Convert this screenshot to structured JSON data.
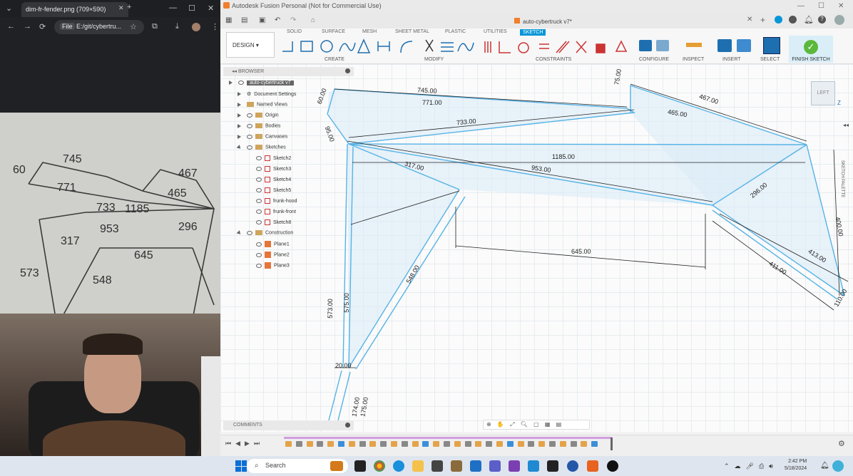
{
  "chrome": {
    "tab_title": "dim-fr-fender.png (709×590)",
    "address_prefix": "File",
    "address": "E:/git/cybertru..."
  },
  "fusion": {
    "window_title": "Autodesk Fusion Personal (Not for Commercial Use)",
    "doc_tab": "auto-cybertruck v7*",
    "tabs": [
      "SOLID",
      "SURFACE",
      "MESH",
      "SHEET METAL",
      "PLASTIC",
      "UTILITIES",
      "SKETCH"
    ],
    "active_tab": "SKETCH",
    "workspace": "DESIGN",
    "groups": [
      "CREATE",
      "MODIFY",
      "CONSTRAINTS",
      "CONFIGURE",
      "INSPECT",
      "INSERT",
      "SELECT"
    ],
    "finish_sketch": "FINISH SKETCH",
    "browser_title": "BROWSER",
    "comments_title": "COMMENTS",
    "viewcube_label": "LEFT",
    "side_palette": "SKETCH PALETTE",
    "browser_items": [
      {
        "label": "auto-cybertruck v7",
        "level": 0
      },
      {
        "label": "Document Settings",
        "level": 1
      },
      {
        "label": "Named Views",
        "level": 1
      },
      {
        "label": "Origin",
        "level": 1
      },
      {
        "label": "Bodies",
        "level": 1
      },
      {
        "label": "Canvases",
        "level": 1
      },
      {
        "label": "Sketches",
        "level": 1
      },
      {
        "label": "Sketch2",
        "level": 2
      },
      {
        "label": "Sketch3",
        "level": 2
      },
      {
        "label": "Sketch4",
        "level": 2
      },
      {
        "label": "Sketch5",
        "level": 2
      },
      {
        "label": "frunk-hood",
        "level": 2
      },
      {
        "label": "frunk-front",
        "level": 2
      },
      {
        "label": "Sketch8",
        "level": 2
      },
      {
        "label": "Construction",
        "level": 1
      },
      {
        "label": "Plane1",
        "level": 2
      },
      {
        "label": "Plane2",
        "level": 2
      },
      {
        "label": "Plane3",
        "level": 2
      }
    ],
    "dimensions": [
      "745.00",
      "771.00",
      "60.00",
      "75.00",
      "467.00",
      "465.00",
      "733.00",
      "95.00",
      "1185.00",
      "317.00",
      "953.00",
      "296.00",
      "645.00",
      "400.00",
      "413.00",
      "411.00",
      "548.00",
      "573.00",
      "575.00",
      "20.00",
      "174.00",
      "175.00",
      "110.00"
    ]
  },
  "taskbar": {
    "search_placeholder": "Search",
    "time": "2:42 PM",
    "date": "5/18/2024"
  }
}
